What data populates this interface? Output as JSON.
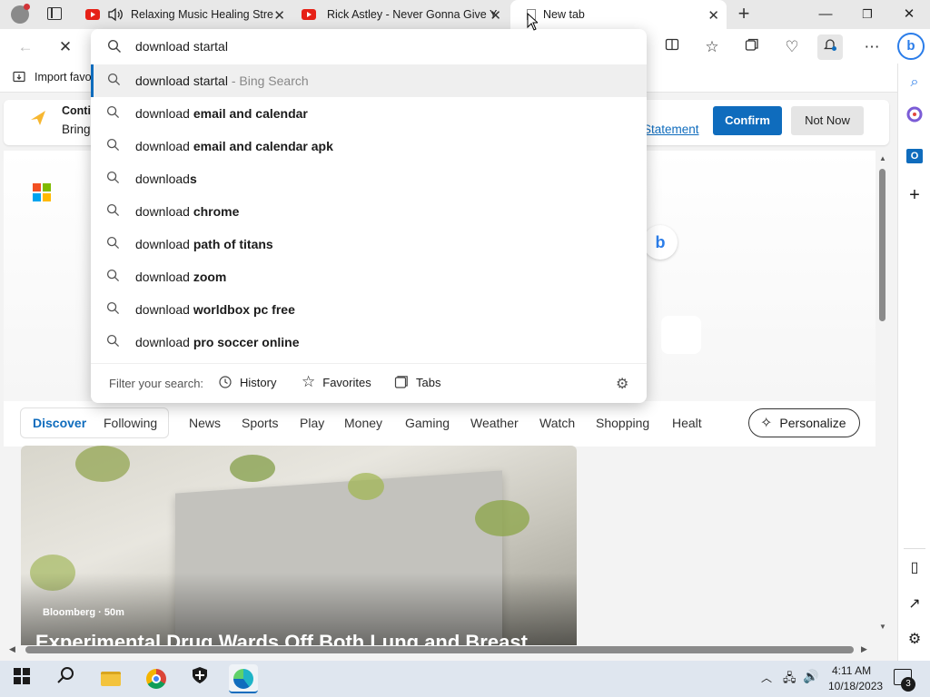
{
  "browser": {
    "tabs": [
      {
        "label": "Relaxing Music Healing Stre",
        "favicon": "youtube-icon"
      },
      {
        "label": "Rick Astley - Never Gonna Give Y",
        "favicon": "youtube-icon"
      },
      {
        "label": "New tab",
        "favicon": "new-tab-icon"
      }
    ],
    "address_value": "download startal",
    "favorites_bar": {
      "import_label": "Import favo"
    }
  },
  "banner": {
    "title": "Conti",
    "body": "Bring",
    "privacy_link": "Statement",
    "confirm_label": "Confirm",
    "notnow_label": "Not Now"
  },
  "suggestions": [
    {
      "prefix": "download startal",
      "bold": "",
      "suffix": " - Bing Search"
    },
    {
      "prefix": "download ",
      "bold": "email and calendar",
      "suffix": ""
    },
    {
      "prefix": "download ",
      "bold": "email and calendar apk",
      "suffix": ""
    },
    {
      "prefix": "download",
      "bold": "s",
      "suffix": ""
    },
    {
      "prefix": "download ",
      "bold": "chrome",
      "suffix": ""
    },
    {
      "prefix": "download ",
      "bold": "path of titans",
      "suffix": ""
    },
    {
      "prefix": "download ",
      "bold": "zoom",
      "suffix": ""
    },
    {
      "prefix": "download ",
      "bold": "worldbox pc free",
      "suffix": ""
    },
    {
      "prefix": "download ",
      "bold": "pro soccer online",
      "suffix": ""
    }
  ],
  "filter": {
    "label": "Filter your search:",
    "history": "History",
    "favorites": "Favorites",
    "tabs": "Tabs"
  },
  "news": {
    "tabs": [
      "Discover",
      "Following",
      "News",
      "Sports",
      "Play",
      "Money",
      "Gaming",
      "Weather",
      "Watch",
      "Shopping",
      "Healt"
    ],
    "personalize_label": "Personalize",
    "card": {
      "source": "Bloomberg · 50m",
      "headline": "Experimental Drug Wards Off Both Lung and Breast"
    }
  },
  "taskbar": {
    "time": "4:11 AM",
    "date": "10/18/2023",
    "notification_count": "3"
  },
  "colors": {
    "accent": "#0f6cbd",
    "youtube": "#e62117",
    "taskbar": "#dfe6ef"
  }
}
